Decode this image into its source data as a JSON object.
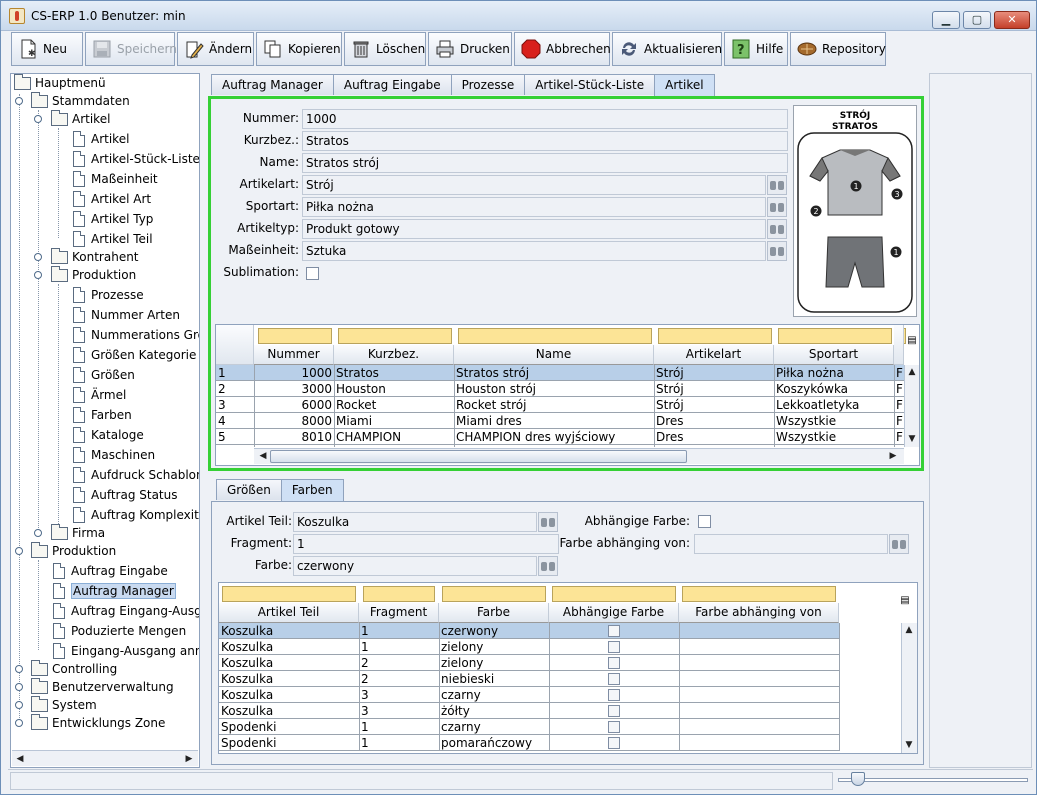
{
  "window": {
    "title": "CS-ERP 1.0  Benutzer: min"
  },
  "toolbar": {
    "buttons": [
      {
        "label": "Neu",
        "icon": "new-document-icon",
        "enabled": true
      },
      {
        "label": "Speichern",
        "icon": "save-disk-icon",
        "enabled": false
      },
      {
        "label": "Ändern",
        "icon": "edit-pencil-icon",
        "enabled": true
      },
      {
        "label": "Kopieren",
        "icon": "copy-icon",
        "enabled": true
      },
      {
        "label": "Löschen",
        "icon": "trash-icon",
        "enabled": true
      },
      {
        "label": "Drucken",
        "icon": "printer-icon",
        "enabled": true
      },
      {
        "label": "Abbrechen",
        "icon": "stop-icon",
        "enabled": true
      },
      {
        "label": "Aktualisieren",
        "icon": "refresh-icon",
        "enabled": true
      },
      {
        "label": "Hilfe",
        "icon": "help-icon",
        "enabled": true
      },
      {
        "label": "Repository",
        "icon": "repository-icon",
        "enabled": true
      }
    ]
  },
  "tree": {
    "root": "Hauptmenü",
    "items": [
      {
        "label": "Stammdaten",
        "type": "folder"
      },
      {
        "label": "Artikel",
        "type": "folder"
      },
      {
        "label": "Artikel",
        "type": "doc"
      },
      {
        "label": "Artikel-Stück-Liste",
        "type": "doc"
      },
      {
        "label": "Maßeinheit",
        "type": "doc"
      },
      {
        "label": "Artikel Art",
        "type": "doc"
      },
      {
        "label": "Artikel Typ",
        "type": "doc"
      },
      {
        "label": "Artikel Teil",
        "type": "doc"
      },
      {
        "label": "Kontrahent",
        "type": "folder"
      },
      {
        "label": "Produktion",
        "type": "folder"
      },
      {
        "label": "Prozesse",
        "type": "doc"
      },
      {
        "label": "Nummer Arten",
        "type": "doc"
      },
      {
        "label": "Nummerations Größe",
        "type": "doc"
      },
      {
        "label": "Größen Kategorie",
        "type": "doc"
      },
      {
        "label": "Größen",
        "type": "doc"
      },
      {
        "label": "Ärmel",
        "type": "doc"
      },
      {
        "label": "Farben",
        "type": "doc"
      },
      {
        "label": "Kataloge",
        "type": "doc"
      },
      {
        "label": "Maschinen",
        "type": "doc"
      },
      {
        "label": "Aufdruck Schablone",
        "type": "doc"
      },
      {
        "label": "Auftrag Status",
        "type": "doc"
      },
      {
        "label": "Auftrag Komplexität",
        "type": "doc"
      },
      {
        "label": "Firma",
        "type": "folder"
      },
      {
        "label": "Produktion",
        "type": "folder"
      },
      {
        "label": "Auftrag Eingabe",
        "type": "doc"
      },
      {
        "label": "Auftrag Manager",
        "type": "doc"
      },
      {
        "label": "Auftrag Eingang-Ausgang",
        "type": "doc"
      },
      {
        "label": "Poduzierte Mengen",
        "type": "doc"
      },
      {
        "label": "Eingang-Ausgang annulieren",
        "type": "doc"
      },
      {
        "label": "Controlling",
        "type": "folder"
      },
      {
        "label": "Benutzerverwaltung",
        "type": "folder"
      },
      {
        "label": "System",
        "type": "folder"
      },
      {
        "label": "Entwicklungs Zone",
        "type": "folder"
      }
    ]
  },
  "main_tabs": [
    "Auftrag Manager",
    "Auftrag Eingabe",
    "Prozesse",
    "Artikel-Stück-Liste",
    "Artikel"
  ],
  "form": {
    "nummer_label": "Nummer:",
    "nummer": "1000",
    "kurzbez_label": "Kurzbez.:",
    "kurzbez": "Stratos",
    "name_label": "Name:",
    "name": "Stratos strój",
    "artikelart_label": "Artikelart:",
    "artikelart": "Strój",
    "sportart_label": "Sportart:",
    "sportart": "Piłka nożna",
    "artikeltyp_label": "Artikeltyp:",
    "artikeltyp": "Produkt gotowy",
    "masseinheit_label": "Maßeinheit:",
    "masseinheit": "Sztuka",
    "sublimation_label": "Sublimation:",
    "image_title_1": "STRÓJ",
    "image_title_2": "STRATOS",
    "image_numbers": [
      "1",
      "2",
      "3",
      "1"
    ]
  },
  "article_table": {
    "headers": [
      "Nummer",
      "Kurzbez.",
      "Name",
      "Artikelart",
      "Sportart"
    ],
    "rows": [
      {
        "n": "1",
        "nummer": "1000",
        "kurzbez": "Stratos",
        "name": "Stratos strój",
        "art": "Strój",
        "sport": "Piłka nożna",
        "extra": "F"
      },
      {
        "n": "2",
        "nummer": "3000",
        "kurzbez": "Houston",
        "name": "Houston strój",
        "art": "Strój",
        "sport": "Koszykówka",
        "extra": "F"
      },
      {
        "n": "3",
        "nummer": "6000",
        "kurzbez": "Rocket",
        "name": "Rocket strój",
        "art": "Strój",
        "sport": "Lekkoatletyka",
        "extra": "F"
      },
      {
        "n": "4",
        "nummer": "8000",
        "kurzbez": "Miami",
        "name": "Miami dres",
        "art": "Dres",
        "sport": "Wszystkie",
        "extra": "F"
      },
      {
        "n": "5",
        "nummer": "8010",
        "kurzbez": "CHAMPION",
        "name": "CHAMPION dres wyjściowy",
        "art": "Dres",
        "sport": "Wszystkie",
        "extra": "F"
      }
    ]
  },
  "sub_tabs": [
    "Größen",
    "Farben"
  ],
  "sub_form": {
    "artikel_teil_label": "Artikel Teil:",
    "artikel_teil": "Koszulka",
    "fragment_label": "Fragment:",
    "fragment": "1",
    "farbe_label": "Farbe:",
    "farbe": "czerwony",
    "abh_farbe_label": "Abhängige Farbe:",
    "farbe_abh_von_label": "Farbe abhänging von:"
  },
  "color_table": {
    "headers": [
      "Artikel Teil",
      "Fragment",
      "Farbe",
      "Abhängige Farbe",
      "Farbe abhänging von"
    ],
    "rows": [
      {
        "teil": "Koszulka",
        "fragment": "1",
        "farbe": "czerwony"
      },
      {
        "teil": "Koszulka",
        "fragment": "1",
        "farbe": "zielony"
      },
      {
        "teil": "Koszulka",
        "fragment": "2",
        "farbe": "zielony"
      },
      {
        "teil": "Koszulka",
        "fragment": "2",
        "farbe": "niebieski"
      },
      {
        "teil": "Koszulka",
        "fragment": "3",
        "farbe": "czarny"
      },
      {
        "teil": "Koszulka",
        "fragment": "3",
        "farbe": "żółty"
      },
      {
        "teil": "Spodenki",
        "fragment": "1",
        "farbe": "czarny"
      },
      {
        "teil": "Spodenki",
        "fragment": "1",
        "farbe": "pomarańczowy"
      }
    ]
  },
  "colors": {
    "selection": "#b8cfe8",
    "active_border": "#35d035",
    "filter_cell": "#fce496"
  }
}
